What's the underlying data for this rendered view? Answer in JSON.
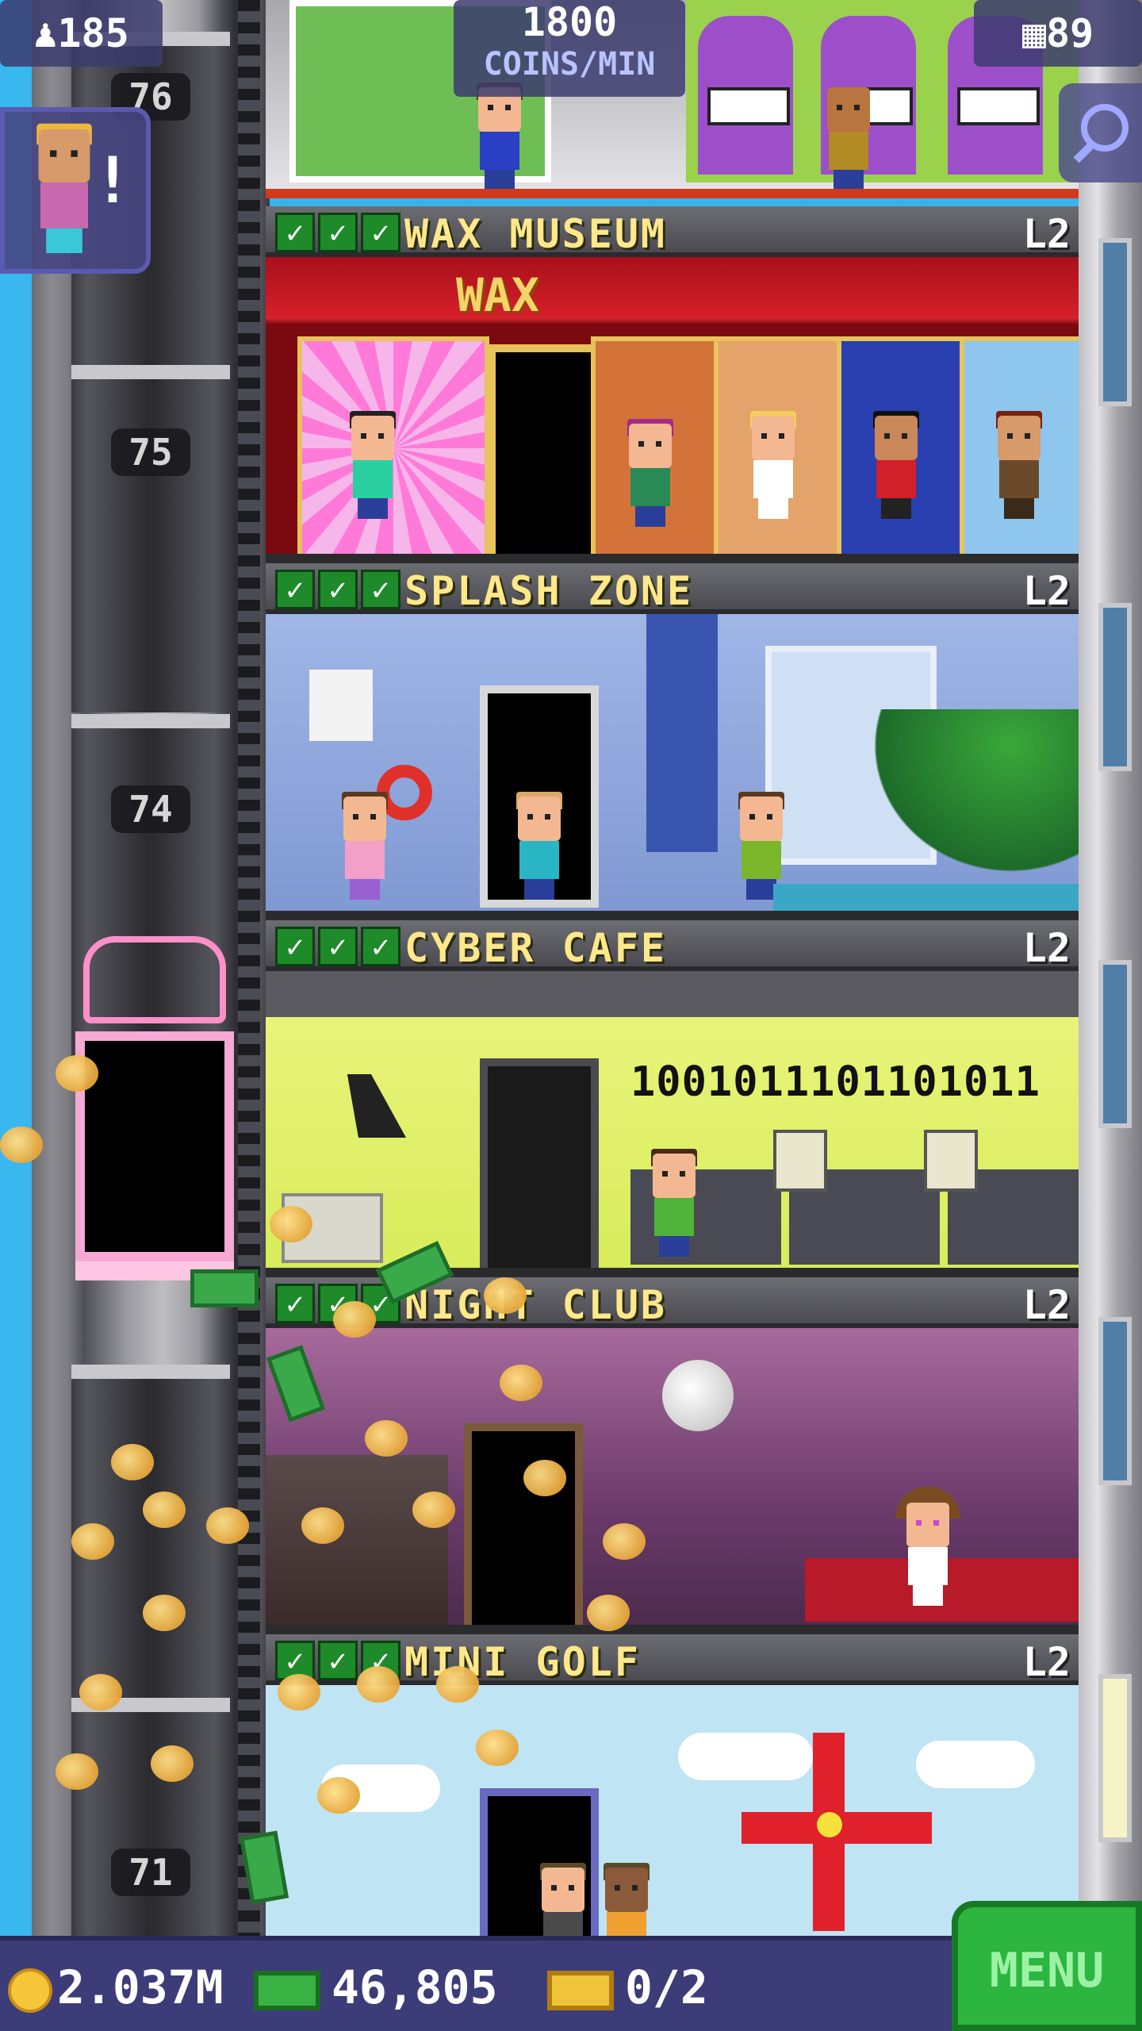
{
  "hud": {
    "population": "185",
    "coins_per_min_value": "1800",
    "coins_per_min_unit": "COINS/MIN",
    "floor_count": "89"
  },
  "shaft_floor_numbers": [
    "76",
    "75",
    "74",
    "71"
  ],
  "floors": [
    {
      "name": "WAX MUSEUM",
      "level": "L2",
      "checks": 3
    },
    {
      "name": "SPLASH ZONE",
      "level": "L2",
      "checks": 3
    },
    {
      "name": "CYBER CAFE",
      "level": "L2",
      "checks": 3
    },
    {
      "name": "NIGHT CLUB",
      "level": "L2",
      "checks": 3
    },
    {
      "name": "MINI GOLF",
      "level": "L2",
      "checks": 3
    }
  ],
  "wax_sign": "WAX",
  "cyber_binary": "1001011101101011",
  "bottom": {
    "coins": "2.037M",
    "bux": "46,805",
    "tickets": "0/2",
    "menu_label": "MENU"
  },
  "icons": {
    "population": "person-icon",
    "floors": "building-icon",
    "search": "search-icon",
    "coin": "coin-icon",
    "bux": "bux-icon",
    "ticket": "ticket-icon"
  },
  "colors": {
    "hud_bg": "#3c3c78",
    "menu_green": "#2cb53f",
    "floor_name": "#ffe88a",
    "sky": "#39b7ef"
  }
}
